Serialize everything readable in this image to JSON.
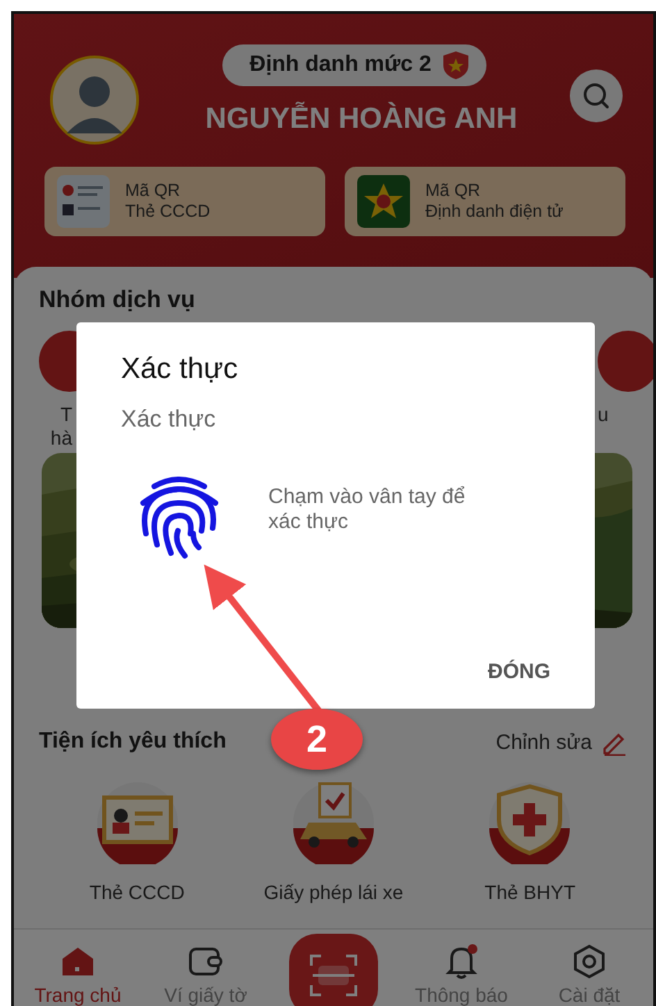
{
  "header": {
    "level_badge": "Định danh mức 2",
    "user_name": "NGUYỄN HOÀNG ANH",
    "qr_cards": [
      {
        "title": "Mã QR",
        "subtitle": "Thẻ CCCD"
      },
      {
        "title": "Mã QR",
        "subtitle": "Định danh điện tử"
      }
    ]
  },
  "services": {
    "title": "Nhóm dịch vụ",
    "items": [
      {
        "label_lines": [
          "T",
          "hà"
        ]
      },
      {
        "label_lines": [
          "u"
        ]
      }
    ]
  },
  "favorites": {
    "title": "Tiện ích yêu thích",
    "edit_link": "Chỉnh sửa",
    "items": [
      {
        "label": "Thẻ CCCD"
      },
      {
        "label": "Giấy phép lái xe"
      },
      {
        "label": "Thẻ BHYT"
      }
    ]
  },
  "bottom_nav": [
    {
      "label": "Trang chủ",
      "selected": true,
      "unread": false
    },
    {
      "label": "Ví giấy tờ",
      "selected": false,
      "unread": false
    },
    {
      "label": "Thông báo",
      "selected": false,
      "unread": true
    },
    {
      "label": "Cài đặt",
      "selected": false,
      "unread": false
    }
  ],
  "dialog": {
    "title": "Xác thực",
    "subtitle": "Xác thực",
    "message": "Chạm vào vân tay để xác thực",
    "button": "ĐÓNG"
  },
  "annotation": {
    "number": "2"
  }
}
